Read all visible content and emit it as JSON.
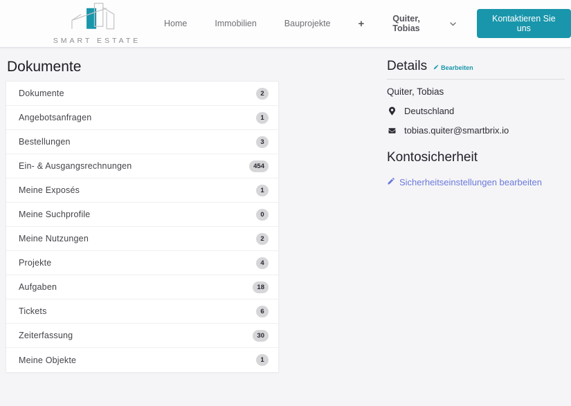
{
  "header": {
    "brand": {
      "name": "SMART ESTATE"
    },
    "nav": [
      {
        "label": "Home"
      },
      {
        "label": "Immobilien"
      },
      {
        "label": "Bauprojekte"
      }
    ],
    "plus_glyph": "+",
    "user_menu": {
      "label": "Quiter, Tobias"
    },
    "contact_button": {
      "label": "Kontaktieren Sie uns"
    }
  },
  "main": {
    "title": "Dokumente",
    "list": {
      "items": [
        {
          "label": "Dokumente",
          "count": "2"
        },
        {
          "label": "Angebotsanfragen",
          "count": "1"
        },
        {
          "label": "Bestellungen",
          "count": "3"
        },
        {
          "label": "Ein- & Ausgangsrechnungen",
          "count": "454"
        },
        {
          "label": "Meine Exposés",
          "count": "1"
        },
        {
          "label": "Meine Suchprofile",
          "count": "0"
        },
        {
          "label": "Meine Nutzungen",
          "count": "2"
        },
        {
          "label": "Projekte",
          "count": "4"
        },
        {
          "label": "Aufgaben",
          "count": "18"
        },
        {
          "label": "Tickets",
          "count": "6"
        },
        {
          "label": "Zeiterfassung",
          "count": "30"
        },
        {
          "label": "Meine Objekte",
          "count": "1"
        }
      ]
    }
  },
  "details_panel": {
    "title": "Details",
    "edit_link_label": "Bearbeiten",
    "name": "Quiter, Tobias",
    "location": "Deutschland",
    "email": "tobias.quiter@smartbrix.io",
    "security": {
      "title": "Kontosicherheit",
      "link_label": "Sicherheitseinstellungen bearbeiten"
    }
  },
  "colors": {
    "accent_teal": "#1996ab",
    "link_indigo": "#6b79da",
    "badge_bg": "#d6d6d9"
  }
}
